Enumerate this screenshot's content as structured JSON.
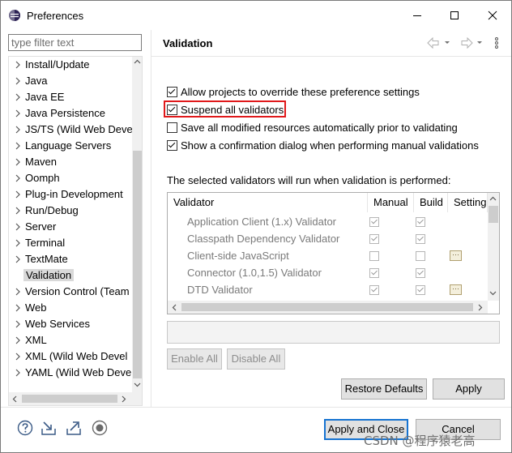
{
  "window": {
    "title": "Preferences",
    "app_icon": "eclipse-icon",
    "controls": [
      "minimize-icon",
      "maximize-icon",
      "close-icon"
    ]
  },
  "filter": {
    "placeholder": "type filter text",
    "value": ""
  },
  "tree": {
    "items": [
      {
        "label": "Install/Update",
        "expandable": true,
        "selected": false
      },
      {
        "label": "Java",
        "expandable": true,
        "selected": false
      },
      {
        "label": "Java EE",
        "expandable": true,
        "selected": false
      },
      {
        "label": "Java Persistence",
        "expandable": true,
        "selected": false
      },
      {
        "label": "JS/TS (Wild Web Deve",
        "expandable": true,
        "selected": false
      },
      {
        "label": "Language Servers",
        "expandable": true,
        "selected": false
      },
      {
        "label": "Maven",
        "expandable": true,
        "selected": false
      },
      {
        "label": "Oomph",
        "expandable": true,
        "selected": false
      },
      {
        "label": "Plug-in Development",
        "expandable": true,
        "selected": false
      },
      {
        "label": "Run/Debug",
        "expandable": true,
        "selected": false
      },
      {
        "label": "Server",
        "expandable": true,
        "selected": false
      },
      {
        "label": "Terminal",
        "expandable": true,
        "selected": false
      },
      {
        "label": "TextMate",
        "expandable": true,
        "selected": false
      },
      {
        "label": "Validation",
        "expandable": false,
        "selected": true
      },
      {
        "label": "Version Control (Team",
        "expandable": true,
        "selected": false
      },
      {
        "label": "Web",
        "expandable": true,
        "selected": false
      },
      {
        "label": "Web Services",
        "expandable": true,
        "selected": false
      },
      {
        "label": "XML",
        "expandable": true,
        "selected": false
      },
      {
        "label": "XML (Wild Web Devel",
        "expandable": true,
        "selected": false
      },
      {
        "label": "YAML (Wild Web Deve",
        "expandable": true,
        "selected": false
      }
    ]
  },
  "page": {
    "title": "Validation",
    "nav_icons": [
      "back-arrow-icon",
      "back-dropdown-icon",
      "forward-arrow-icon",
      "forward-dropdown-icon",
      "view-menu-icon"
    ]
  },
  "options": [
    {
      "label": "Allow projects to override these preference settings",
      "checked": true
    },
    {
      "label": "Suspend all validators",
      "checked": true,
      "highlighted": true
    },
    {
      "label": "Save all modified resources automatically prior to validating",
      "checked": false
    },
    {
      "label": "Show a confirmation dialog when performing manual validations",
      "checked": true
    }
  ],
  "validators_caption": "The selected validators will run when validation is performed:",
  "table": {
    "columns": [
      "Validator",
      "Manual",
      "Build",
      "Setting"
    ],
    "rows": [
      {
        "name": "Application Client (1.x) Validator",
        "manual": true,
        "build": true,
        "settings": false
      },
      {
        "name": "Classpath Dependency Validator",
        "manual": true,
        "build": true,
        "settings": false
      },
      {
        "name": "Client-side JavaScript",
        "manual": false,
        "build": false,
        "settings": true
      },
      {
        "name": "Connector (1.0,1.5) Validator",
        "manual": true,
        "build": true,
        "settings": false
      },
      {
        "name": "DTD Validator",
        "manual": true,
        "build": true,
        "settings": true
      }
    ],
    "settings_glyph": "···"
  },
  "buttons": {
    "enable_all": "Enable All",
    "disable_all": "Disable All",
    "restore_defaults": "Restore Defaults",
    "apply": "Apply",
    "apply_and_close": "Apply and Close",
    "cancel": "Cancel"
  },
  "bottom_icons": [
    "help-icon",
    "import-icon",
    "export-icon",
    "record-icon"
  ],
  "watermark": "CSDN @程序猿老高",
  "colors": {
    "highlight_border": "#e0191b",
    "default_button_border": "#1673d1",
    "selection_background": "#d9d9d9"
  }
}
